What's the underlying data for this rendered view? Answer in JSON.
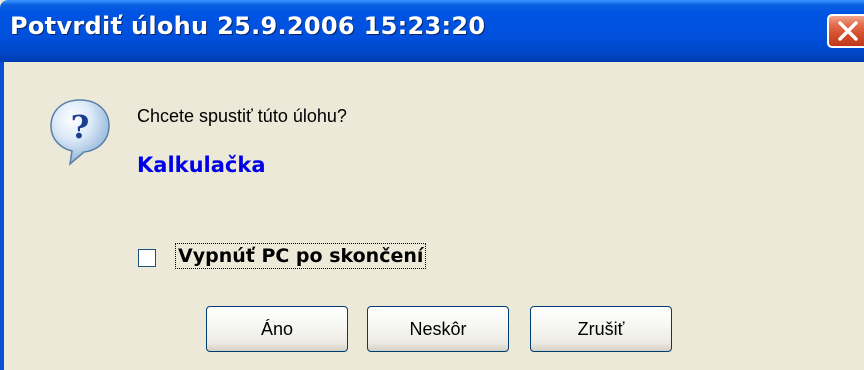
{
  "window": {
    "title": "Potvrdiť úlohu 25.9.2006 15:23:20"
  },
  "dialog": {
    "prompt": "Chcete spustiť túto úlohu?",
    "task_name": "Kalkulačka",
    "icon": "question-icon",
    "checkbox": {
      "label": "Vypnúť PC po skončení",
      "checked": false
    },
    "buttons": {
      "yes": "Áno",
      "later": "Neskôr",
      "cancel": "Zrušiť"
    }
  },
  "colors": {
    "titlebar": "#0054e3",
    "task_name": "#0000e6",
    "close_button": "#d4502f",
    "background": "#ece9d8"
  }
}
